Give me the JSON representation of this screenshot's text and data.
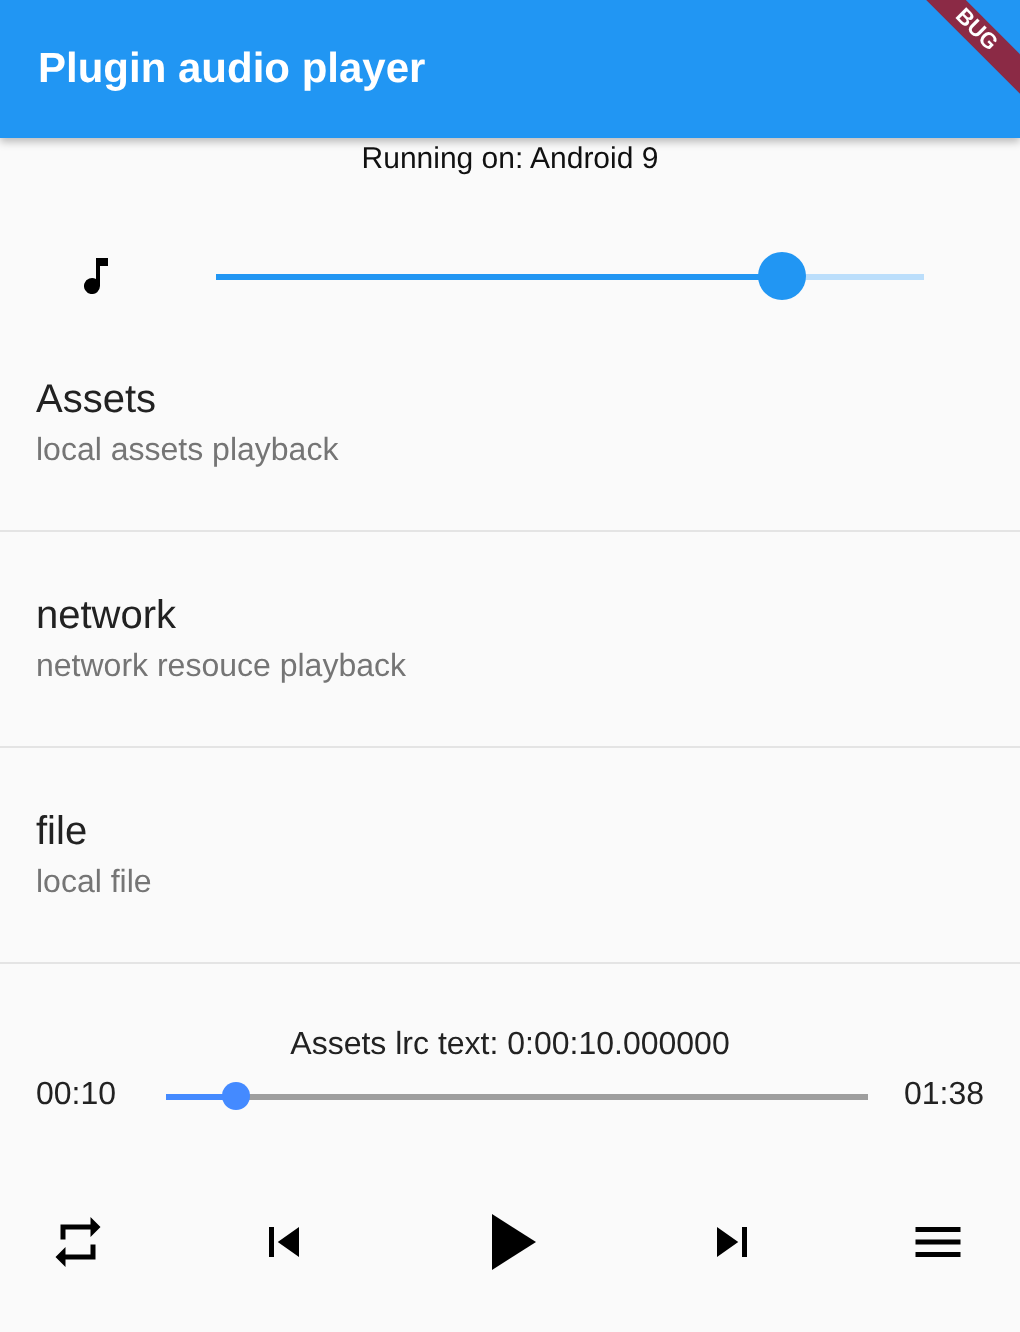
{
  "app_bar": {
    "title": "Plugin audio player",
    "debug_banner": "BUG"
  },
  "platform_text": "Running on: Android 9",
  "volume": {
    "level": 0.8
  },
  "list_items": [
    {
      "title": "Assets",
      "subtitle": "local assets playback"
    },
    {
      "title": "network",
      "subtitle": "network resouce playback"
    },
    {
      "title": "file",
      "subtitle": "local file"
    }
  ],
  "lyrics_text": "Assets lrc text: 0:00:10.000000",
  "progress": {
    "elapsed": "00:10",
    "duration": "01:38",
    "level": 0.1
  },
  "controls": [
    {
      "kind": "repeat"
    },
    {
      "kind": "previous"
    },
    {
      "kind": "play"
    },
    {
      "kind": "next"
    },
    {
      "kind": "playlist"
    }
  ]
}
